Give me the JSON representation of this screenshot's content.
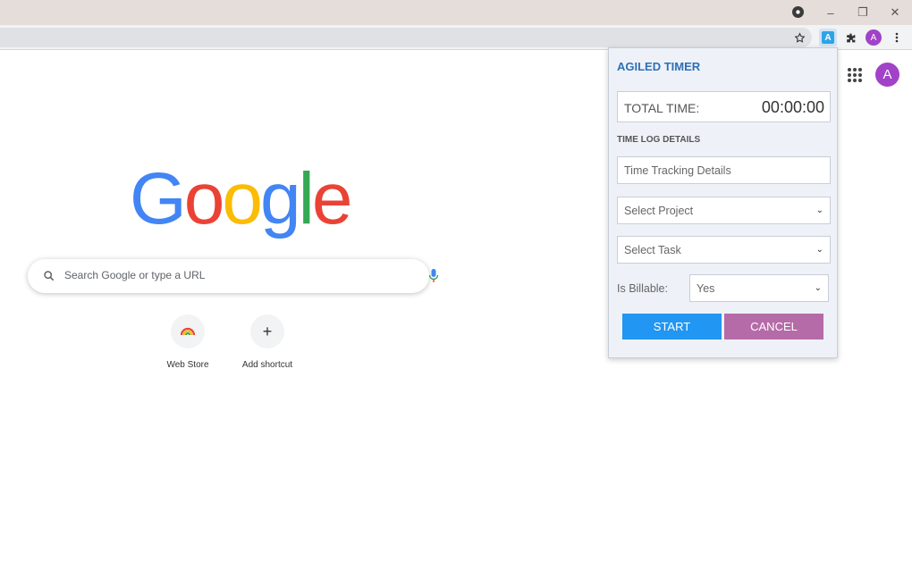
{
  "browser": {
    "window_controls": {
      "minimize": "–",
      "restore": "❐",
      "close": "✕"
    },
    "profile_initial": "A"
  },
  "ntp": {
    "logo_letters": [
      {
        "ch": "G",
        "color": "#4285F4"
      },
      {
        "ch": "o",
        "color": "#EA4335"
      },
      {
        "ch": "o",
        "color": "#FBBC05"
      },
      {
        "ch": "g",
        "color": "#4285F4"
      },
      {
        "ch": "l",
        "color": "#34A853"
      },
      {
        "ch": "e",
        "color": "#EA4335"
      }
    ],
    "search_placeholder": "Search Google or type a URL",
    "avatar_initial": "A",
    "shortcuts": [
      {
        "label": "Web Store",
        "icon": "rainbow-icon"
      },
      {
        "label": "Add shortcut",
        "icon": "plus-icon",
        "glyph": "+"
      }
    ]
  },
  "popup": {
    "title": "AGILED TIMER",
    "total_time_label": "TOTAL TIME:",
    "total_time_value": "00:00:00",
    "section_label": "TIME LOG DETAILS",
    "details_placeholder": "Time Tracking Details",
    "project_select": "Select Project",
    "task_select": "Select Task",
    "billable_label": "Is Billable:",
    "billable_value": "Yes",
    "start_label": "START",
    "cancel_label": "CANCEL",
    "colors": {
      "title": "#2e6fb7",
      "start": "#2196f3",
      "cancel": "#b56ba8",
      "background": "#eef2f8"
    }
  }
}
